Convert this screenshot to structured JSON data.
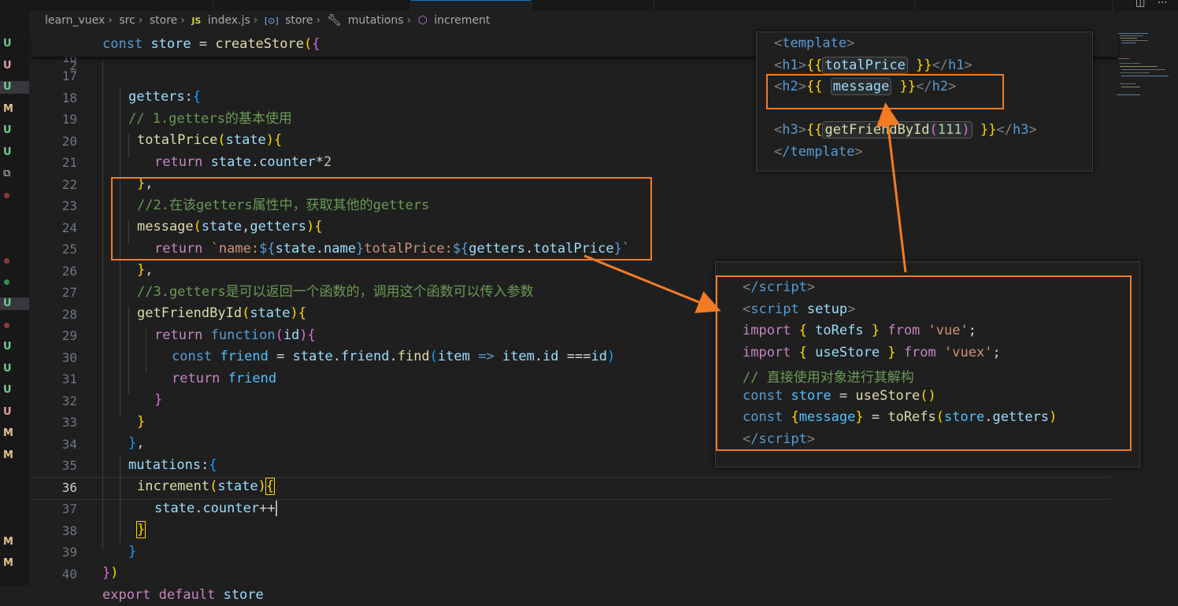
{
  "breadcrumb": [
    "learn_vuex",
    "src",
    "store",
    "index.js",
    "store",
    "mutations",
    "increment"
  ],
  "breadcrumb_icons": {
    "file": "JS",
    "store": "box-icon",
    "mutations": "wrench-icon",
    "increment": "cube-icon"
  },
  "git_status": [
    "U",
    "U",
    "U",
    "M",
    "U",
    "U",
    "U",
    "U",
    "U",
    "U",
    "U",
    "M",
    "M",
    "M",
    "M"
  ],
  "sticky": {
    "num": "2",
    "text": "const store = createStore({"
  },
  "editor": {
    "lines": [
      {
        "n": "16"
      },
      {
        "n": "17"
      },
      {
        "n": "18"
      },
      {
        "n": "19"
      },
      {
        "n": "20"
      },
      {
        "n": "21"
      },
      {
        "n": "22"
      },
      {
        "n": "23"
      },
      {
        "n": "24"
      },
      {
        "n": "25"
      },
      {
        "n": "26"
      },
      {
        "n": "27"
      },
      {
        "n": "28"
      },
      {
        "n": "29"
      },
      {
        "n": "30"
      },
      {
        "n": "31"
      },
      {
        "n": "32"
      },
      {
        "n": "33"
      },
      {
        "n": "34"
      },
      {
        "n": "35"
      },
      {
        "n": "36"
      },
      {
        "n": "37"
      },
      {
        "n": "38"
      },
      {
        "n": "39"
      },
      {
        "n": "40"
      }
    ],
    "t": {
      "getters": "getters",
      "c1": "// 1.getters的基本使用",
      "totalPrice": "totalPrice",
      "state": "state",
      "ret": "return",
      "counter": "counter",
      "c2": "//2.在该getters属性中，获取其他的getters",
      "message": "message",
      "gettersArg": "getters",
      "tpl1": "`name:",
      "name": "name",
      "tpl2": "totalPrice:",
      "tpl3": "`",
      "c3": "//3.getters是可以返回一个函数的，调用这个函数可以传入参数",
      "getFriendById": "getFriendById",
      "function": "function",
      "id": "id",
      "const": "const",
      "friend": "friend",
      "find": "find",
      "item": "item",
      "mutations": "mutations",
      "increment": "increment",
      "export": "export",
      "default": "default",
      "store": "store"
    }
  },
  "template_panel": {
    "open": "template",
    "h1": "h1",
    "totalPrice": "totalPrice",
    "h2": "h2",
    "message": "message",
    "h3": "h3",
    "getFriendById": "getFriendById",
    "arg": "111",
    "close": "/template"
  },
  "script_panel": {
    "close_script": "/script",
    "script": "script",
    "setup": "setup",
    "import": "import",
    "toRefs": "toRefs",
    "from": "from",
    "vue": "'vue'",
    "useStore": "useStore",
    "vuex": "'vuex'",
    "comment": "// 直接使用对象进行其解构",
    "const": "const",
    "store": "store",
    "message": "message",
    "getters": "getters"
  },
  "colors": {
    "highlight": "#f37b24",
    "background": "#1f1f1f"
  }
}
